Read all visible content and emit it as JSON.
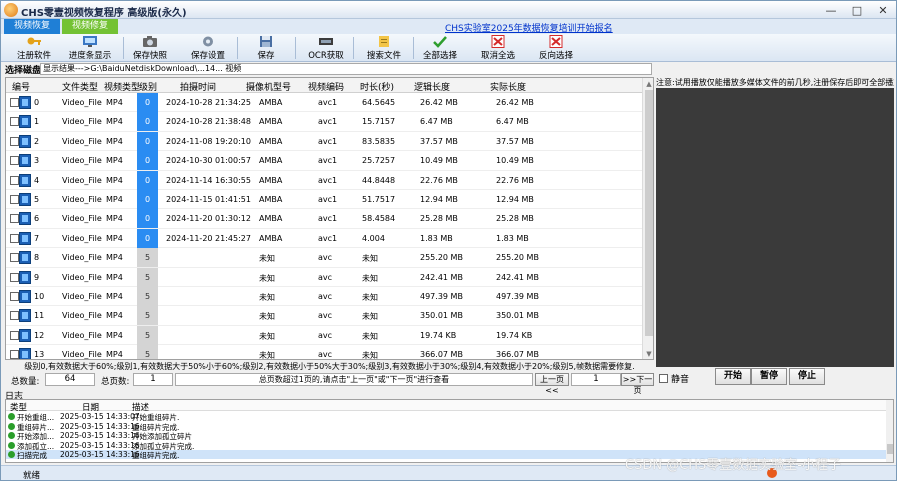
{
  "window": {
    "title": "CHS零壹视频恢复程序 高级版(永久)",
    "minimize": "—",
    "maximize": "□",
    "close": "✕"
  },
  "menu": {
    "tab_recover": "视频恢复",
    "tab_repair": "视频修复",
    "promo": "CHS实验室2025年数据恢复培训开始报名"
  },
  "toolbar": [
    {
      "label": "注册软件",
      "icon": "key-icon"
    },
    {
      "label": "进度条显示",
      "icon": "monitor-icon"
    },
    {
      "label": "保存快照",
      "icon": "camera-icon"
    },
    {
      "label": "保存设置",
      "icon": "settings-save-icon"
    },
    {
      "label": "保存",
      "icon": "save-icon"
    },
    {
      "label": "OCR获取",
      "icon": "ocr-icon"
    },
    {
      "label": "搜索文件",
      "icon": "folder-search-icon"
    },
    {
      "label": "全部选择",
      "icon": "check-all-icon"
    },
    {
      "label": "取消全选",
      "icon": "uncheck-icon"
    },
    {
      "label": "反向选择",
      "icon": "invert-select-icon"
    }
  ],
  "path_row": {
    "label": "选择磁盘",
    "value": "显示结果--->G:\\BaiduNetdiskDownload\\...14...    视频"
  },
  "table": {
    "headers": [
      "编号",
      "文件类型",
      "视频类型",
      "级别",
      "拍摄时间",
      "摄像机型号",
      "视频编码",
      "时长(秒)",
      "逻辑长度",
      "实际长度"
    ],
    "rows": [
      [
        "0",
        "Video_File",
        "MP4",
        "0",
        "2024-10-28 21:34:25",
        "AMBA",
        "avc1",
        "64.5645",
        "26.42 MB",
        "26.42 MB"
      ],
      [
        "1",
        "Video_File",
        "MP4",
        "0",
        "2024-10-28 21:38:48",
        "AMBA",
        "avc1",
        "15.7157",
        "6.47 MB",
        "6.47 MB"
      ],
      [
        "2",
        "Video_File",
        "MP4",
        "0",
        "2024-11-08 19:20:10",
        "AMBA",
        "avc1",
        "83.5835",
        "37.57 MB",
        "37.57 MB"
      ],
      [
        "3",
        "Video_File",
        "MP4",
        "0",
        "2024-10-30 01:00:57",
        "AMBA",
        "avc1",
        "25.7257",
        "10.49 MB",
        "10.49 MB"
      ],
      [
        "4",
        "Video_File",
        "MP4",
        "0",
        "2024-11-14 16:30:55",
        "AMBA",
        "avc1",
        "44.8448",
        "22.76 MB",
        "22.76 MB"
      ],
      [
        "5",
        "Video_File",
        "MP4",
        "0",
        "2024-11-15 01:41:51",
        "AMBA",
        "avc1",
        "51.7517",
        "12.94 MB",
        "12.94 MB"
      ],
      [
        "6",
        "Video_File",
        "MP4",
        "0",
        "2024-11-20 01:30:12",
        "AMBA",
        "avc1",
        "58.4584",
        "25.28 MB",
        "25.28 MB"
      ],
      [
        "7",
        "Video_File",
        "MP4",
        "0",
        "2024-11-20 21:45:27",
        "AMBA",
        "avc1",
        "4.004",
        "1.83 MB",
        "1.83 MB"
      ],
      [
        "8",
        "Video_File",
        "MP4",
        "5",
        "",
        "未知",
        "avc",
        "未知",
        "255.20 MB",
        "255.20 MB"
      ],
      [
        "9",
        "Video_File",
        "MP4",
        "5",
        "",
        "未知",
        "avc",
        "未知",
        "242.41 MB",
        "242.41 MB"
      ],
      [
        "10",
        "Video_File",
        "MP4",
        "5",
        "",
        "未知",
        "avc",
        "未知",
        "497.39 MB",
        "497.39 MB"
      ],
      [
        "11",
        "Video_File",
        "MP4",
        "5",
        "",
        "未知",
        "avc",
        "未知",
        "350.01 MB",
        "350.01 MB"
      ],
      [
        "12",
        "Video_File",
        "MP4",
        "5",
        "",
        "未知",
        "avc",
        "未知",
        "19.74 KB",
        "19.74 KB"
      ],
      [
        "13",
        "Video_File",
        "MP4",
        "5",
        "",
        "未知",
        "avc",
        "未知",
        "366.07 MB",
        "366.07 MB"
      ]
    ]
  },
  "legend": "级别0,有效数据大于60%;级别1,有效数据大于50%小于60%;级别2,有效数据小于50%大于30%;级别3,有效数据小于30%;级别4,有效数据小于20%;级别5,帧数据需要修复.",
  "pager": {
    "total_label": "总数量:",
    "total": "64",
    "pages_label": "总页数:",
    "pages": "1",
    "hint": "总页数超过1页的,请点击\"上一页\"或\"下一页\"进行查看",
    "prev": "上一页<<",
    "page": "1",
    "next": ">>下一页"
  },
  "preview": {
    "note": "注意:试用播放仅能播放多媒体文件的前几秒,注册保存后即可全部播放!",
    "mute": "静音",
    "play": "开始",
    "pause": "暂停",
    "stop": "停止"
  },
  "log": {
    "title": "日志",
    "headers": [
      "类型",
      "日期",
      "描述"
    ],
    "rows": [
      [
        "开始重组...",
        "2025-03-15 14:33:07",
        "开始重组碎片."
      ],
      [
        "重组碎片...",
        "2025-03-15 14:33:16",
        "重组碎片完成."
      ],
      [
        "开始添加...",
        "2025-03-15 14:33:16",
        "开始添加孤立碎片"
      ],
      [
        "添加孤立...",
        "2025-03-15 14:33:16",
        "添加孤立碎片完成."
      ],
      [
        "扫描完成",
        "2025-03-15 14:33:16",
        "重组碎片完成."
      ]
    ]
  },
  "status": {
    "text": "就绪"
  },
  "watermark": "CSDN @CHS零壹数据实验室-小程子",
  "colors": {
    "level_blue": "#2a8cf2",
    "level_grey": "#d4d4d4",
    "tab_recover": "#1f7fd6",
    "tab_repair": "#74c234",
    "preview_bg": "#3a3a3a"
  }
}
